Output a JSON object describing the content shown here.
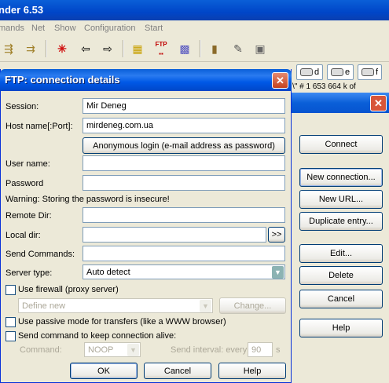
{
  "main_window": {
    "title": "nder 6.53",
    "menu": [
      "mands",
      "Net",
      "Show",
      "Configuration",
      "Start"
    ],
    "toolbar_icons": [
      "pack-icon",
      "unpack-icon",
      "star-icon",
      "back-icon",
      "forward-icon",
      "cube-icon",
      "ftp-connect-icon",
      "ftp-new-icon",
      "notes-icon",
      "edit-icon",
      "image-icon"
    ],
    "ftp_icon_label": "FTP",
    "drives": [
      "d",
      "e",
      "f"
    ],
    "status_text": "\\\"  #  1 653 664 k of"
  },
  "connect_dialog": {
    "buttons": {
      "connect": "Connect",
      "new_connection": "New connection...",
      "new_url": "New URL...",
      "duplicate": "Duplicate entry...",
      "edit": "Edit...",
      "delete": "Delete",
      "cancel": "Cancel",
      "help": "Help"
    }
  },
  "dialog": {
    "title": "FTP: connection details",
    "session": {
      "label": "Session:",
      "value": "Mir Deneg"
    },
    "host": {
      "label": "Host name[:Port]:",
      "value": "mirdeneg.com.ua"
    },
    "anonymous_button": "Anonymous login (e-mail address as password)",
    "user": {
      "label": "User name:",
      "value": ""
    },
    "password": {
      "label": "Password",
      "value": ""
    },
    "warning": "Warning: Storing the password is insecure!",
    "remote_dir": {
      "label": "Remote Dir:",
      "value": ""
    },
    "local_dir": {
      "label": "Local dir:",
      "value": "",
      "browse_label": ">>"
    },
    "send_commands": {
      "label": "Send Commands:",
      "value": ""
    },
    "server_type": {
      "label": "Server type:",
      "value": "Auto detect"
    },
    "firewall": {
      "label": "Use firewall (proxy server)",
      "checked": false,
      "select_value": "Define new",
      "change_button": "Change..."
    },
    "passive": {
      "label": "Use passive mode for transfers (like a WWW browser)",
      "checked": false
    },
    "keepalive": {
      "label": "Send command to keep connection alive:",
      "checked": false,
      "command_label": "Command:",
      "command_value": "NOOP",
      "interval_label": "Send interval: every",
      "interval_value": "90",
      "interval_unit": "s"
    },
    "buttons": {
      "ok": "OK",
      "cancel": "Cancel",
      "help": "Help"
    }
  }
}
